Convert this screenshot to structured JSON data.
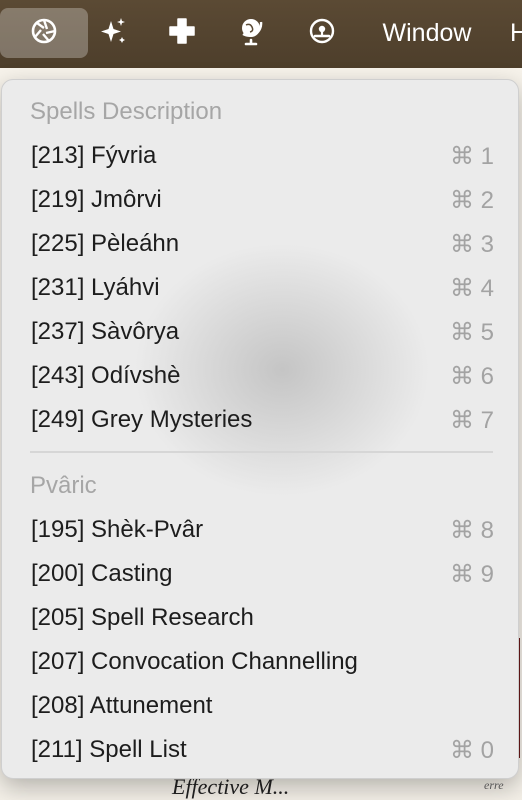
{
  "menubar": {
    "window_label": "Window",
    "truncated_label": "H",
    "icons": [
      "aperture-icon",
      "sparkles-icon",
      "plus-icon",
      "globe-icon",
      "medal-icon"
    ]
  },
  "background_doc": {
    "bottom_fragment": "Effective M...",
    "right_fragment": "erre"
  },
  "menu": {
    "sections": [
      {
        "title": "Spells Description",
        "items": [
          {
            "label": "[213] Fývria",
            "shortcut": "⌘ 1"
          },
          {
            "label": "[219] Jmôrvi",
            "shortcut": "⌘ 2"
          },
          {
            "label": "[225] Pèleáhn",
            "shortcut": "⌘ 3"
          },
          {
            "label": "[231] Lyáhvi",
            "shortcut": "⌘ 4"
          },
          {
            "label": "[237] Sàvôrya",
            "shortcut": "⌘ 5"
          },
          {
            "label": "[243] Odívshè",
            "shortcut": "⌘ 6"
          },
          {
            "label": "[249] Grey Mysteries",
            "shortcut": "⌘ 7"
          }
        ]
      },
      {
        "title": "Pvâric",
        "items": [
          {
            "label": "[195] Shèk-Pvâr",
            "shortcut": "⌘ 8"
          },
          {
            "label": "[200] Casting",
            "shortcut": "⌘ 9"
          },
          {
            "label": "[205] Spell Research",
            "shortcut": ""
          },
          {
            "label": "[207] Convocation Channelling",
            "shortcut": ""
          },
          {
            "label": "[208] Attunement",
            "shortcut": ""
          },
          {
            "label": "[211] Spell List",
            "shortcut": "⌘ 0"
          }
        ]
      }
    ]
  }
}
